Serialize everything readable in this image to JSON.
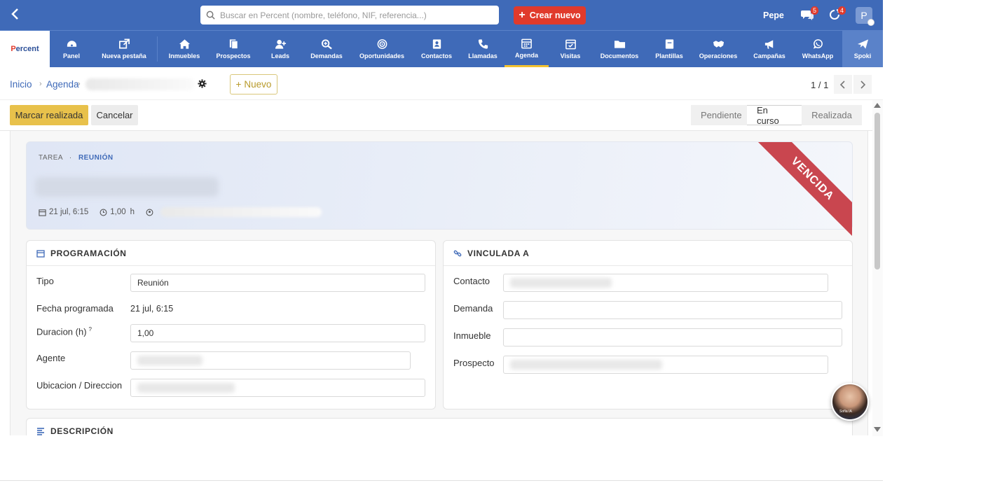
{
  "topbar": {
    "search_placeholder": "Buscar en Percent (nombre, teléfono, NIF, referencia...)",
    "create_label": "Crear nuevo",
    "user_name": "Pepe",
    "chat_badge": "5",
    "notif_badge": "4",
    "avatar_initial": "P"
  },
  "logo": {
    "part1": "P",
    "part2": "ercent"
  },
  "nav": {
    "items": [
      {
        "label": "Panel",
        "icon": "dashboard-icon"
      },
      {
        "label": "Nueva pestaña",
        "icon": "external-link-icon"
      },
      {
        "label": "Inmuebles",
        "icon": "home-icon"
      },
      {
        "label": "Prospectos",
        "icon": "files-icon"
      },
      {
        "label": "Leads",
        "icon": "user-plus-icon"
      },
      {
        "label": "Demandas",
        "icon": "search-plus-icon"
      },
      {
        "label": "Oportunidades",
        "icon": "target-icon"
      },
      {
        "label": "Contactos",
        "icon": "contact-card-icon"
      },
      {
        "label": "Llamadas",
        "icon": "phone-icon"
      },
      {
        "label": "Agenda",
        "icon": "calendar-icon"
      },
      {
        "label": "Visitas",
        "icon": "calendar-check-icon"
      },
      {
        "label": "Documentos",
        "icon": "folder-icon"
      },
      {
        "label": "Plantillas",
        "icon": "template-icon"
      },
      {
        "label": "Operaciones",
        "icon": "handshake-icon"
      },
      {
        "label": "Campañas",
        "icon": "megaphone-icon"
      },
      {
        "label": "WhatsApp",
        "icon": "whatsapp-icon"
      },
      {
        "label": "Spoki",
        "icon": "paper-plane-icon"
      }
    ],
    "active": "Agenda"
  },
  "breadcrumb": {
    "home": "Inicio",
    "section": "Agenda",
    "new_label": "Nuevo",
    "new_plus": "+",
    "pager": "1 / 1"
  },
  "actions": {
    "mark_done": "Marcar realizada",
    "cancel": "Cancelar",
    "status_steps": [
      "Pendiente",
      "En curso",
      "Realizada"
    ],
    "current_status": "En curso"
  },
  "header_card": {
    "type_tag": "TAREA",
    "separator": "·",
    "subtype_tag": "REUNIÓN",
    "date": "21 jul, 6:15",
    "duration": "1,00",
    "duration_unit": "h",
    "ribbon": "VENCIDA"
  },
  "programacion": {
    "title": "PROGRAMACIÓN",
    "tipo_label": "Tipo",
    "tipo_value": "Reunión",
    "fecha_label": "Fecha programada",
    "fecha_value": "21 jul, 6:15",
    "duracion_label": "Duracion (h)",
    "duracion_help": "?",
    "duracion_value": "1,00",
    "agente_label": "Agente",
    "ubicacion_label": "Ubicacion / Direccion"
  },
  "vinculada": {
    "title": "VINCULADA A",
    "contacto_label": "Contacto",
    "demanda_label": "Demanda",
    "inmueble_label": "Inmueble",
    "prospecto_label": "Prospecto"
  },
  "descripcion": {
    "title": "DESCRIPCIÓN"
  },
  "assistant": {
    "tag": "Sofía IA"
  },
  "colors": {
    "brand_blue": "#3f6ab8",
    "create_red": "#e03a2c",
    "primary_yellow": "#e8c14b",
    "ribbon_red": "#c9464f"
  }
}
